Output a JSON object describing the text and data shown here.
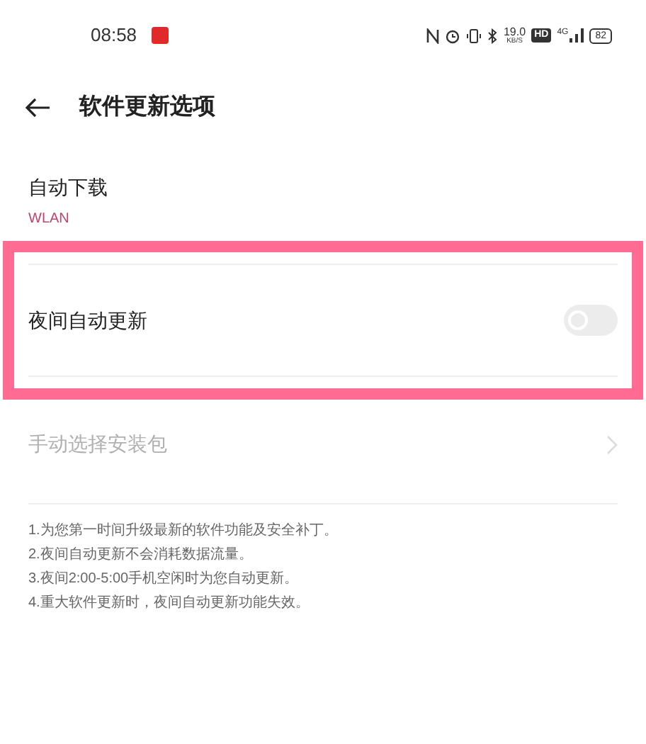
{
  "status_bar": {
    "time": "08:58",
    "speed": "19.0",
    "speed_unit": "KB/S",
    "hd": "HD",
    "network": "4G",
    "battery": "82"
  },
  "header": {
    "title": "软件更新选项"
  },
  "settings": [
    {
      "kind": "value",
      "label": "自动下载",
      "value": "WLAN",
      "disabled": false,
      "highlighted": false
    },
    {
      "kind": "toggle",
      "label": "夜间自动更新",
      "on": false,
      "disabled": false,
      "highlighted": true
    },
    {
      "kind": "link",
      "label": "手动选择安装包",
      "disabled": true,
      "highlighted": false
    }
  ],
  "notes": [
    "1.为您第一时间升级最新的软件功能及安全补丁。",
    "2.夜间自动更新不会消耗数据流量。",
    "3.夜间2:00-5:00手机空闲时为您自动更新。",
    "4.重大软件更新时，夜间自动更新功能失效。"
  ]
}
